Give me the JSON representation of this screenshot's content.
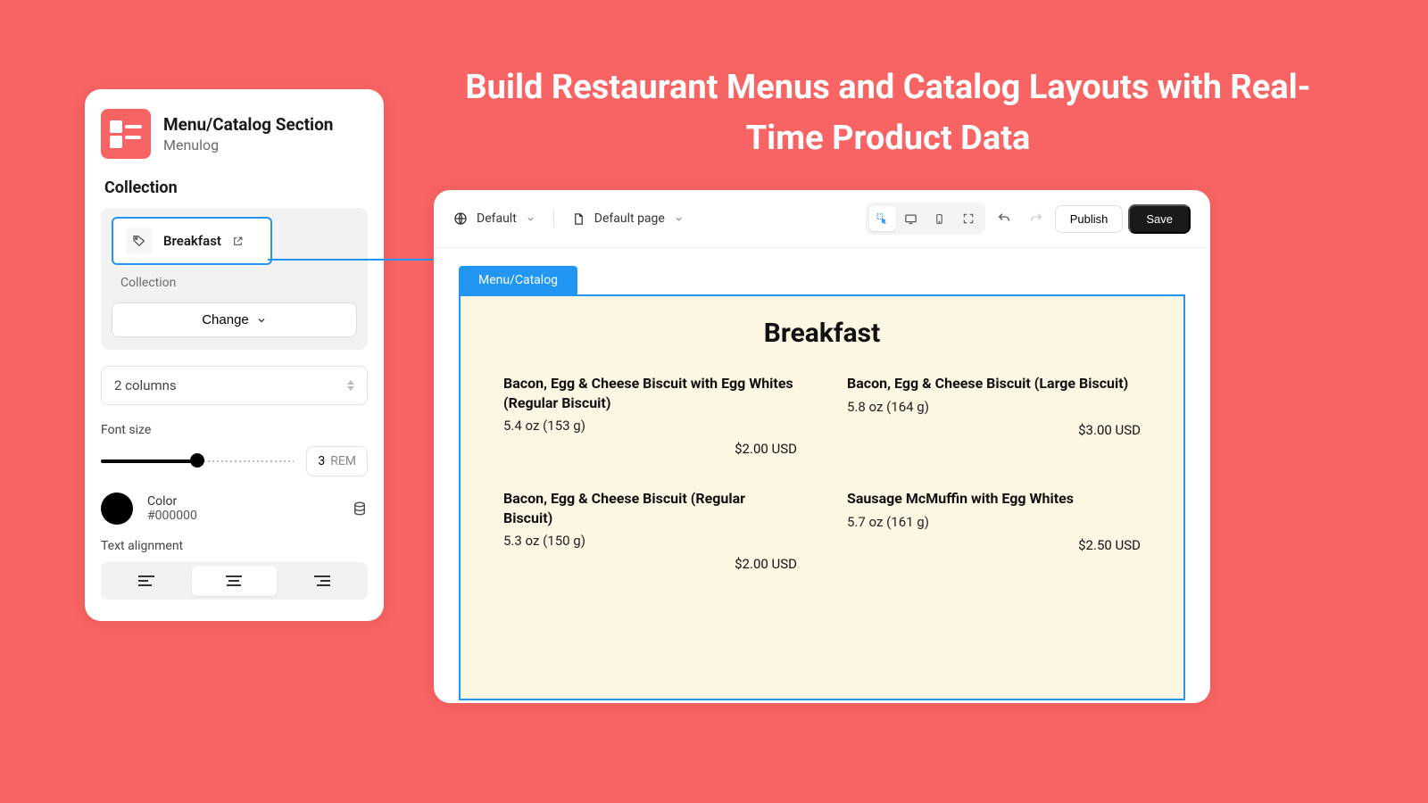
{
  "headline": "Build Restaurant Menus and Catalog Layouts with Real-Time Product Data",
  "sidebar": {
    "title": "Menu/Catalog Section",
    "subtitle": "Menulog",
    "section_label": "Collection",
    "chip_label": "Breakfast",
    "sublabel": "Collection",
    "change_label": "Change",
    "columns_label": "2 columns",
    "font_size_label": "Font size",
    "font_size_value": "3",
    "font_size_unit": "REM",
    "color_label": "Color",
    "color_value": "#000000",
    "text_align_label": "Text alignment"
  },
  "toolbar": {
    "theme_label": "Default",
    "page_label": "Default page",
    "publish_label": "Publish",
    "save_label": "Save"
  },
  "canvas": {
    "tab_label": "Menu/Catalog",
    "menu_title": "Breakfast",
    "items": [
      {
        "name": "Bacon, Egg & Cheese Biscuit with Egg Whites (Regular Biscuit)",
        "size": "5.4 oz (153 g)",
        "price": "$2.00 USD"
      },
      {
        "name": "Bacon, Egg & Cheese Biscuit (Large Biscuit)",
        "size": "5.8 oz (164 g)",
        "price": "$3.00 USD"
      },
      {
        "name": "Bacon, Egg & Cheese Biscuit (Regular Biscuit)",
        "size": "5.3 oz (150 g)",
        "price": "$2.00 USD"
      },
      {
        "name": "Sausage McMuffin with Egg Whites",
        "size": "5.7 oz (161 g)",
        "price": "$2.50 USD"
      }
    ]
  }
}
